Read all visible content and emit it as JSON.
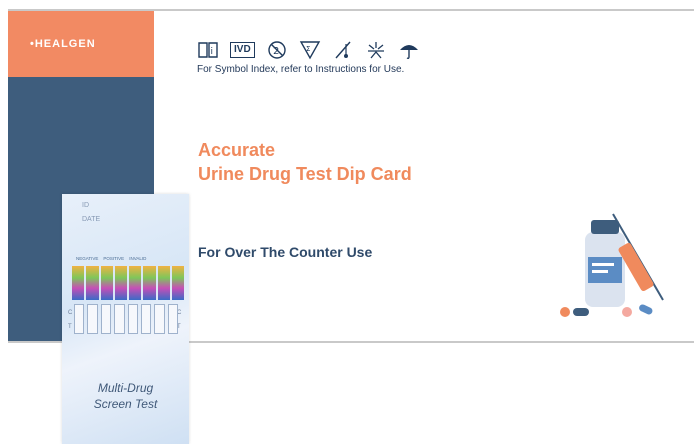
{
  "brand": {
    "logo_text": "•HEALGEN"
  },
  "symbols": {
    "items": [
      "instructions-icon",
      "ivd-label",
      "do-not-reuse-icon",
      "contains-tests-icon",
      "temperature-limit-icon",
      "keep-away-sunlight-icon",
      "keep-dry-icon"
    ],
    "ivd_text": "IVD",
    "note": "For Symbol Index, refer to Instructions for Use."
  },
  "product": {
    "title_line1": "Accurate",
    "title_line2": "Urine Drug Test Dip Card",
    "subtitle": "For Over The Counter Use"
  },
  "card": {
    "id_label": "ID",
    "date_label": "DATE",
    "negative_label": "NEGATIVE",
    "positive_label": "POSITIVE",
    "invalid_label": "INVALID",
    "c_label": "C",
    "t_label": "T",
    "name_line1": "Multi-Drug",
    "name_line2": "Screen Test"
  },
  "colors": {
    "accent_orange": "#f28a63",
    "side_blue": "#3e5d7d",
    "title_color": "#f08a5d",
    "text_dark": "#2f4a6a"
  }
}
